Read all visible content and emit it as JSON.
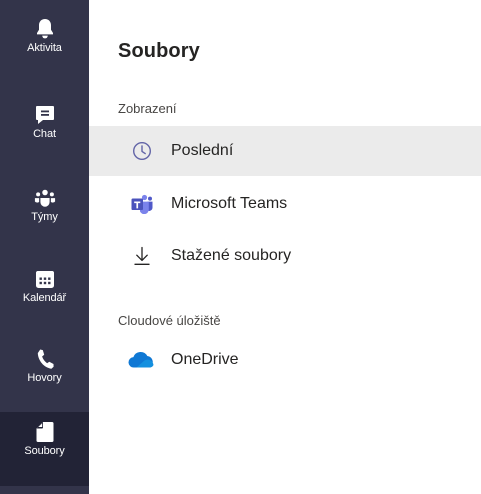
{
  "rail": {
    "items": [
      {
        "label": "Aktivita",
        "icon": "bell-icon"
      },
      {
        "label": "Chat",
        "icon": "chat-icon"
      },
      {
        "label": "Týmy",
        "icon": "teams-icon"
      },
      {
        "label": "Kalendář",
        "icon": "calendar-icon"
      },
      {
        "label": "Hovory",
        "icon": "phone-icon"
      },
      {
        "label": "Soubory",
        "icon": "file-icon",
        "active": true
      }
    ]
  },
  "main": {
    "title": "Soubory",
    "views_section": "Zobrazení",
    "views": [
      {
        "label": "Poslední",
        "icon": "clock-icon",
        "selected": true
      },
      {
        "label": "Microsoft Teams",
        "icon": "microsoft-teams-icon"
      },
      {
        "label": "Stažené soubory",
        "icon": "download-icon"
      }
    ],
    "cloud_section": "Cloudové úložiště",
    "cloud": [
      {
        "label": "OneDrive",
        "icon": "onedrive-icon"
      }
    ]
  },
  "colors": {
    "rail_bg": "#33344a",
    "rail_active_bg": "#222336",
    "selected_row_bg": "#ebebeb",
    "accent": "#6264a7",
    "onedrive": "#0f78d4"
  }
}
